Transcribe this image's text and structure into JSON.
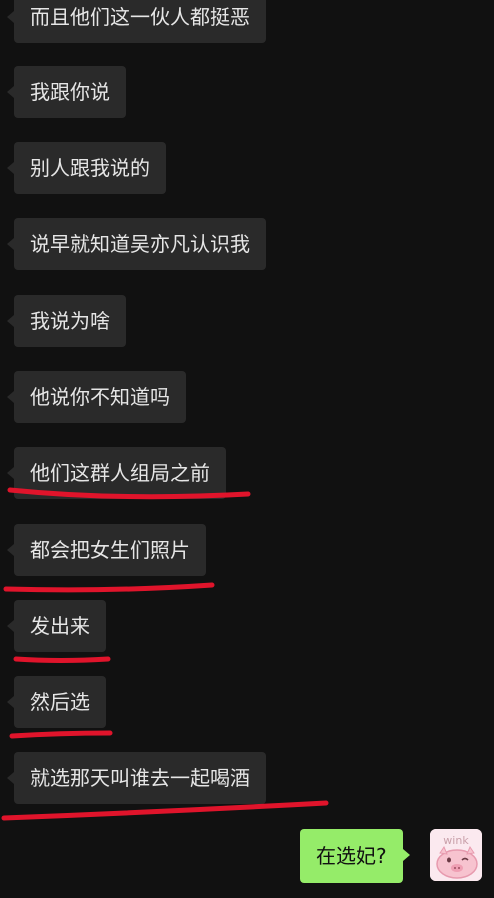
{
  "messages": [
    {
      "side": "incoming",
      "text": "而且他们这一伙人都挺恶"
    },
    {
      "side": "incoming",
      "text": "我跟你说"
    },
    {
      "side": "incoming",
      "text": "别人跟我说的"
    },
    {
      "side": "incoming",
      "text": "说早就知道吴亦凡认识我"
    },
    {
      "side": "incoming",
      "text": "我说为啥"
    },
    {
      "side": "incoming",
      "text": "他说你不知道吗"
    },
    {
      "side": "incoming",
      "text": "他们这群人组局之前",
      "underlined": true
    },
    {
      "side": "incoming",
      "text": "都会把女生们照片",
      "underlined": true
    },
    {
      "side": "incoming",
      "text": "发出来",
      "underlined": true
    },
    {
      "side": "incoming",
      "text": "然后选",
      "underlined": true
    },
    {
      "side": "incoming",
      "text": "就选那天叫谁去一起喝酒",
      "underlined": true
    },
    {
      "side": "outgoing",
      "text": "在选妃?"
    }
  ],
  "self_avatar": {
    "sticker_text": "wink",
    "icon": "pig-sticker-icon"
  },
  "colors": {
    "background": "#111111",
    "incoming_bubble": "#2a2a2a",
    "outgoing_bubble": "#95ec69",
    "underline": "#e0142b"
  }
}
